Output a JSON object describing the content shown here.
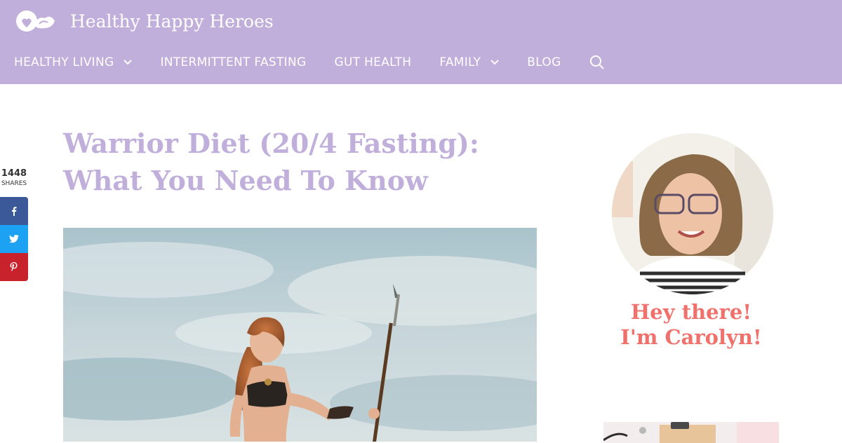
{
  "site": {
    "name": "Healthy Happy Heroes",
    "brand_color": "#c0aedb"
  },
  "nav": {
    "items": [
      {
        "label": "HEALTHY LIVING",
        "has_dropdown": true
      },
      {
        "label": "INTERMITTENT FASTING",
        "has_dropdown": false
      },
      {
        "label": "GUT HEALTH",
        "has_dropdown": false
      },
      {
        "label": "FAMILY",
        "has_dropdown": true
      },
      {
        "label": "BLOG",
        "has_dropdown": false
      }
    ],
    "search_icon": "search-icon"
  },
  "share": {
    "count": "1448",
    "label": "SHARES",
    "buttons": [
      {
        "network": "facebook",
        "icon": "facebook-icon",
        "color": "#3b5998"
      },
      {
        "network": "twitter",
        "icon": "twitter-icon",
        "color": "#1da1f2"
      },
      {
        "network": "pinterest",
        "icon": "pinterest-icon",
        "color": "#c8232c"
      }
    ]
  },
  "article": {
    "title": "Warrior Diet (20/4 Fasting): What You Need To Know",
    "title_color": "#c0aedb"
  },
  "sidebar": {
    "greeting_line1": "Hey there!",
    "greeting_line2": "I'm Carolyn!",
    "greeting_color": "#f0706b"
  }
}
